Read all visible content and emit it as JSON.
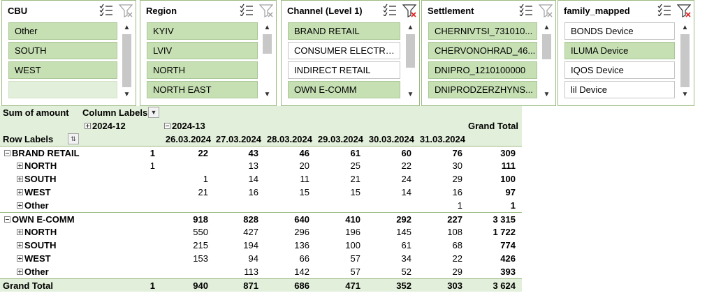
{
  "slicers": [
    {
      "title": "CBU",
      "items": [
        {
          "label": "Other",
          "state": "sel"
        },
        {
          "label": "SOUTH",
          "state": "sel"
        },
        {
          "label": "WEST",
          "state": "sel"
        },
        {
          "label": "",
          "state": "empty"
        }
      ],
      "filter_cleared": false
    },
    {
      "title": "Region",
      "items": [
        {
          "label": "KYIV",
          "state": "sel"
        },
        {
          "label": "LVIV",
          "state": "sel"
        },
        {
          "label": "NORTH",
          "state": "sel"
        },
        {
          "label": "NORTH EAST",
          "state": "sel"
        }
      ],
      "filter_cleared": false
    },
    {
      "title": "Channel (Level 1)",
      "items": [
        {
          "label": "BRAND RETAIL",
          "state": "sel"
        },
        {
          "label": "CONSUMER ELECTRO...",
          "state": "unsel"
        },
        {
          "label": "INDIRECT RETAIL",
          "state": "unsel"
        },
        {
          "label": "OWN E-COMM",
          "state": "sel"
        }
      ],
      "filter_cleared": true
    },
    {
      "title": "Settlement",
      "items": [
        {
          "label": "CHERNIVTSI_731010...",
          "state": "sel"
        },
        {
          "label": "CHERVONOHRAD_46...",
          "state": "sel"
        },
        {
          "label": "DNIPRO_1210100000",
          "state": "sel"
        },
        {
          "label": "DNIPRODZERZHYNS...",
          "state": "sel"
        }
      ],
      "filter_cleared": false
    },
    {
      "title": "family_mapped",
      "items": [
        {
          "label": "BONDS Device",
          "state": "unsel"
        },
        {
          "label": "ILUMA Device",
          "state": "sel"
        },
        {
          "label": "IQOS Device",
          "state": "unsel"
        },
        {
          "label": "lil Device",
          "state": "unsel"
        }
      ],
      "filter_cleared": true
    }
  ],
  "pivot": {
    "value_field": "Sum of amount",
    "column_labels": "Column Labels",
    "row_labels": "Row Labels",
    "year_groups": [
      "2024-12",
      "2024-13"
    ],
    "date_columns": [
      "26.03.2024",
      "27.03.2024",
      "28.03.2024",
      "29.03.2024",
      "30.03.2024",
      "31.03.2024"
    ],
    "grand_total_label": "Grand Total",
    "rows": [
      {
        "label": "BRAND RETAIL",
        "level": 0,
        "values": [
          "1",
          "22",
          "43",
          "46",
          "61",
          "60",
          "76",
          "309"
        ]
      },
      {
        "label": "NORTH",
        "level": 1,
        "values": [
          "1",
          "",
          "13",
          "20",
          "25",
          "22",
          "30",
          "111"
        ]
      },
      {
        "label": "SOUTH",
        "level": 1,
        "values": [
          "",
          "1",
          "14",
          "11",
          "21",
          "24",
          "29",
          "100"
        ]
      },
      {
        "label": "WEST",
        "level": 1,
        "values": [
          "",
          "21",
          "16",
          "15",
          "15",
          "14",
          "16",
          "97"
        ]
      },
      {
        "label": "Other",
        "level": 1,
        "values": [
          "",
          "",
          "",
          "",
          "",
          "",
          "1",
          "1"
        ]
      },
      {
        "label": "OWN E-COMM",
        "level": 0,
        "values": [
          "",
          "918",
          "828",
          "640",
          "410",
          "292",
          "227",
          "3 315"
        ]
      },
      {
        "label": "NORTH",
        "level": 1,
        "values": [
          "",
          "550",
          "427",
          "296",
          "196",
          "145",
          "108",
          "1 722"
        ]
      },
      {
        "label": "SOUTH",
        "level": 1,
        "values": [
          "",
          "215",
          "194",
          "136",
          "100",
          "61",
          "68",
          "774"
        ]
      },
      {
        "label": "WEST",
        "level": 1,
        "values": [
          "",
          "153",
          "94",
          "66",
          "57",
          "34",
          "22",
          "426"
        ]
      },
      {
        "label": "Other",
        "level": 1,
        "values": [
          "",
          "",
          "113",
          "142",
          "57",
          "52",
          "29",
          "393"
        ]
      }
    ],
    "grand_total_values": [
      "1",
      "940",
      "871",
      "686",
      "471",
      "352",
      "303",
      "3 624"
    ]
  },
  "colors": {
    "selected_item": "#c6e0b4",
    "header_band": "#e2efda",
    "border": "#9bbb80",
    "clear_filter_red": "#e02020"
  },
  "icons": {
    "multiselect": "multi-select-icon",
    "clear_filter": "clear-filter-icon",
    "scroll_up": "▲",
    "scroll_down": "▼",
    "dropdown": "▼",
    "sort_filter": "⇅"
  }
}
